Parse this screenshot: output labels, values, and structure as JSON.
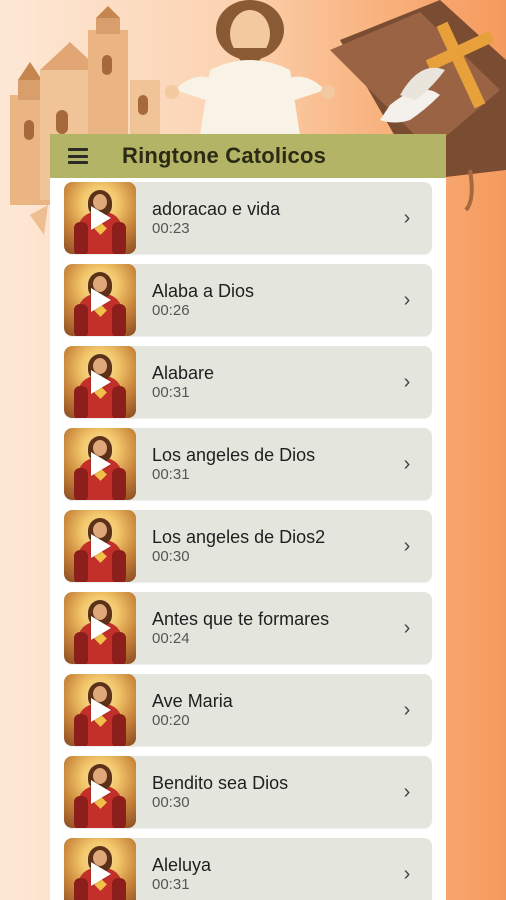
{
  "app_bar": {
    "title": "Ringtone Catolicos",
    "menu_icon": "hamburger-menu-icon"
  },
  "ringtones": [
    {
      "name": "adoracao e vida",
      "duration": "00:23"
    },
    {
      "name": "Alaba a Dios",
      "duration": "00:26"
    },
    {
      "name": "Alabare",
      "duration": "00:31"
    },
    {
      "name": "Los angeles de Dios",
      "duration": "00:31"
    },
    {
      "name": "Los angeles de Dios2",
      "duration": "00:30"
    },
    {
      "name": "Antes que te formares",
      "duration": "00:24"
    },
    {
      "name": "Ave Maria",
      "duration": "00:20"
    },
    {
      "name": "Bendito sea Dios",
      "duration": "00:30"
    },
    {
      "name": "Aleluya",
      "duration": "00:31"
    }
  ],
  "colors": {
    "app_bar": "#b3b465",
    "item_background": "#e4e6de",
    "background_start": "#fde8d6",
    "background_end": "#f59a5e"
  },
  "icons": {
    "item_thumbnail": "sacred-heart-thumbnail",
    "play": "play-icon",
    "chevron": "chevron-right-icon"
  }
}
